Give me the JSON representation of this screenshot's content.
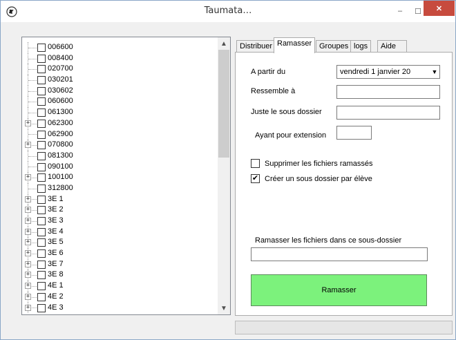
{
  "window": {
    "title": "Taumata…",
    "minimize_icon": "minimize-icon",
    "maximize_icon": "maximize-icon",
    "close_icon": "close-icon",
    "min_glyph": "–",
    "max_glyph": "☐",
    "close_glyph": "✕"
  },
  "tree": {
    "items": [
      {
        "label": "006600",
        "expandable": false
      },
      {
        "label": "008400",
        "expandable": false
      },
      {
        "label": "020700",
        "expandable": false
      },
      {
        "label": "030201",
        "expandable": false
      },
      {
        "label": "030602",
        "expandable": false
      },
      {
        "label": "060600",
        "expandable": false
      },
      {
        "label": "061300",
        "expandable": false
      },
      {
        "label": "062300",
        "expandable": true
      },
      {
        "label": "062900",
        "expandable": false
      },
      {
        "label": "070800",
        "expandable": true
      },
      {
        "label": "081300",
        "expandable": false
      },
      {
        "label": "090100",
        "expandable": false
      },
      {
        "label": "100100",
        "expandable": true
      },
      {
        "label": "312800",
        "expandable": false
      },
      {
        "label": "3E 1",
        "expandable": true
      },
      {
        "label": "3E 2",
        "expandable": true
      },
      {
        "label": "3E 3",
        "expandable": true
      },
      {
        "label": "3E 4",
        "expandable": true
      },
      {
        "label": "3E 5",
        "expandable": true
      },
      {
        "label": "3E 6",
        "expandable": true
      },
      {
        "label": "3E 7",
        "expandable": true
      },
      {
        "label": "3E 8",
        "expandable": true
      },
      {
        "label": "4E 1",
        "expandable": true
      },
      {
        "label": "4E 2",
        "expandable": true
      },
      {
        "label": "4E 3",
        "expandable": true
      }
    ],
    "expander_glyph": "+"
  },
  "tabs": [
    {
      "label": "Distribuer",
      "active": false
    },
    {
      "label": "Ramasser",
      "active": true
    },
    {
      "label": "Groupes",
      "active": false
    },
    {
      "label": "logs",
      "active": false
    },
    {
      "label": "Aide",
      "active": false
    }
  ],
  "ramasser": {
    "from_label": "A partir du",
    "date_value": "vendredi    1    janvier    20",
    "date_dropdown_glyph": "▼",
    "resembles_label": "Ressemble à",
    "resembles_value": "",
    "subfolder_label": "Juste le sous dossier",
    "subfolder_value": "",
    "extension_label": "Ayant pour extension",
    "extension_value": "",
    "delete_label": "Supprimer les fichiers ramassés",
    "delete_checked": false,
    "create_label": "Créer un sous dossier par élève",
    "create_checked": true,
    "check_glyph": "✔",
    "target_label": "Ramasser les fichiers dans ce sous-dossier",
    "target_value": "",
    "button_label": "Ramasser",
    "button_color": "#7cf27c"
  },
  "progress": {
    "value": 0
  }
}
